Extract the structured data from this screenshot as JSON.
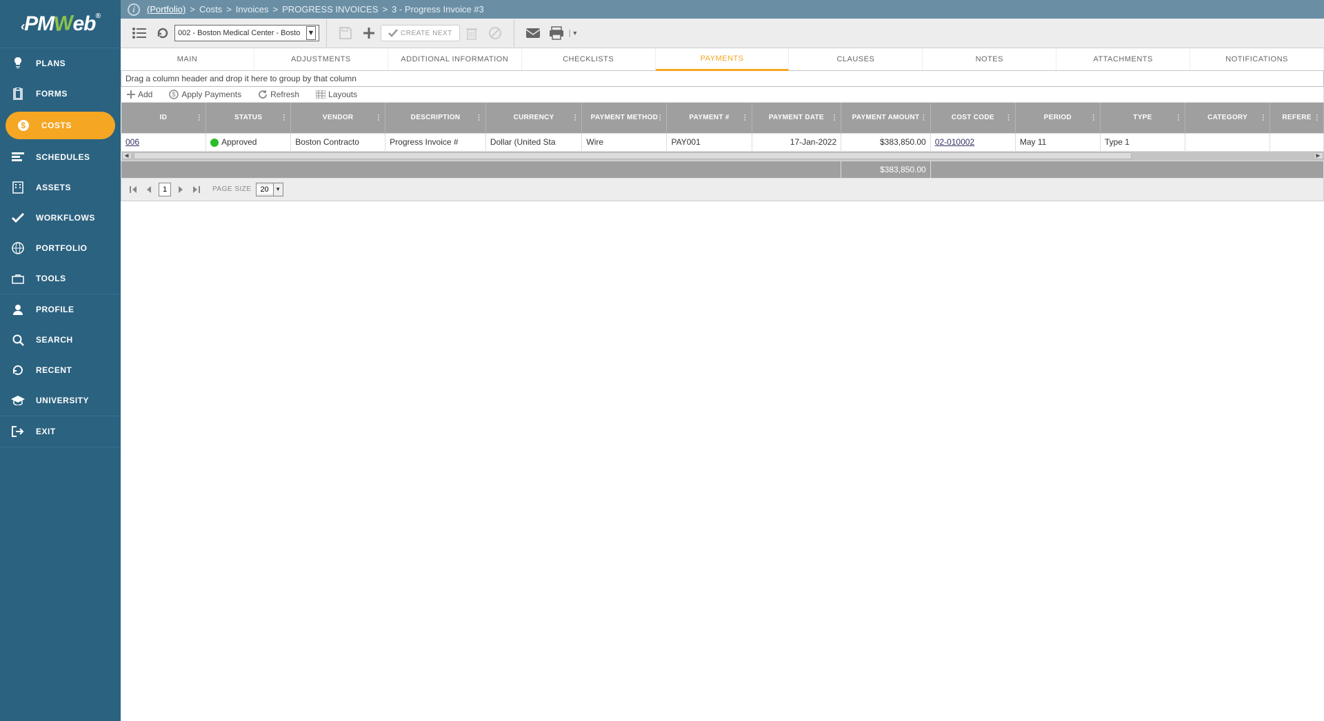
{
  "logo": {
    "pm": "PM",
    "w": "W",
    "eb": "eb",
    "reg": "®"
  },
  "sidebar": {
    "items": [
      {
        "label": "PLANS"
      },
      {
        "label": "FORMS"
      },
      {
        "label": "COSTS"
      },
      {
        "label": "SCHEDULES"
      },
      {
        "label": "ASSETS"
      },
      {
        "label": "WORKFLOWS"
      },
      {
        "label": "PORTFOLIO"
      },
      {
        "label": "TOOLS"
      }
    ],
    "items2": [
      {
        "label": "PROFILE"
      },
      {
        "label": "SEARCH"
      },
      {
        "label": "RECENT"
      },
      {
        "label": "UNIVERSITY"
      }
    ],
    "items3": [
      {
        "label": "EXIT"
      }
    ]
  },
  "breadcrumb": {
    "portfolio": "(Portfolio)",
    "p1": "Costs",
    "p2": "Invoices",
    "p3": "PROGRESS INVOICES",
    "p4": "3 - Progress Invoice #3"
  },
  "toolbar": {
    "project": "002 - Boston Medical Center - Bosto",
    "create_next": "CREATE NEXT"
  },
  "tabs": [
    "MAIN",
    "ADJUSTMENTS",
    "ADDITIONAL INFORMATION",
    "CHECKLISTS",
    "PAYMENTS",
    "CLAUSES",
    "NOTES",
    "ATTACHMENTS",
    "NOTIFICATIONS"
  ],
  "group_hint": "Drag a column header and drop it here to group by that column",
  "actions": {
    "add": "Add",
    "apply": "Apply Payments",
    "refresh": "Refresh",
    "layouts": "Layouts"
  },
  "columns": [
    "ID",
    "STATUS",
    "VENDOR",
    "DESCRIPTION",
    "CURRENCY",
    "PAYMENT METHOD",
    "PAYMENT #",
    "PAYMENT DATE",
    "PAYMENT AMOUNT",
    "COST CODE",
    "PERIOD",
    "TYPE",
    "CATEGORY",
    "REFERE"
  ],
  "row": {
    "id": "006",
    "status": "Approved",
    "vendor": "Boston Contracto",
    "description": "Progress Invoice #",
    "currency": "Dollar (United Sta",
    "method": "Wire",
    "paynum": "PAY001",
    "date": "17-Jan-2022",
    "amount": "$383,850.00",
    "costcode": "02-010002",
    "period": "May 11",
    "type": "Type 1",
    "category": "",
    "ref": ""
  },
  "total": "$383,850.00",
  "pager": {
    "page": "1",
    "size_label": "PAGE SIZE",
    "size": "20"
  }
}
